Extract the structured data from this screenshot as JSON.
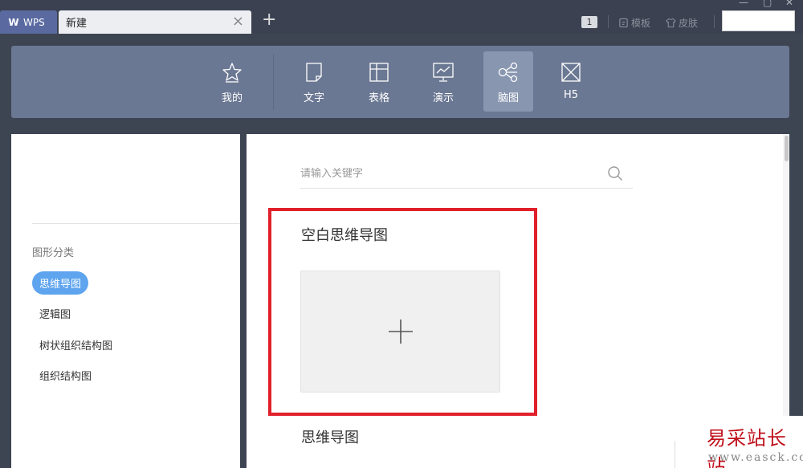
{
  "titlebar": {
    "app_tab": "WPS",
    "doc_tab": "新建",
    "badge": "1",
    "template_link": "模板",
    "skin_link": "皮肤"
  },
  "categories": [
    {
      "label": "我的",
      "icon": "star-icon"
    },
    {
      "label": "文字",
      "icon": "document-icon"
    },
    {
      "label": "表格",
      "icon": "spreadsheet-icon"
    },
    {
      "label": "演示",
      "icon": "presentation-icon"
    },
    {
      "label": "脑图",
      "icon": "mindmap-icon",
      "active": true
    },
    {
      "label": "H5",
      "icon": "h5-icon"
    }
  ],
  "sidebar": {
    "title": "图形分类",
    "items": [
      {
        "label": "思维导图",
        "active": true
      },
      {
        "label": "逻辑图"
      },
      {
        "label": "树状组织结构图"
      },
      {
        "label": "组织结构图"
      }
    ]
  },
  "main": {
    "search_placeholder": "请输入关键字",
    "blank_section_title": "空白思维导图",
    "mindmap_section_title": "思维导图"
  },
  "watermark": {
    "title": "易采站长站",
    "url": "www.easck.com"
  },
  "colors": {
    "titlebar": "#3b4150",
    "category_bar": "#6b7893",
    "active_item": "#5ea4ee",
    "highlight_border": "#e0202a"
  }
}
